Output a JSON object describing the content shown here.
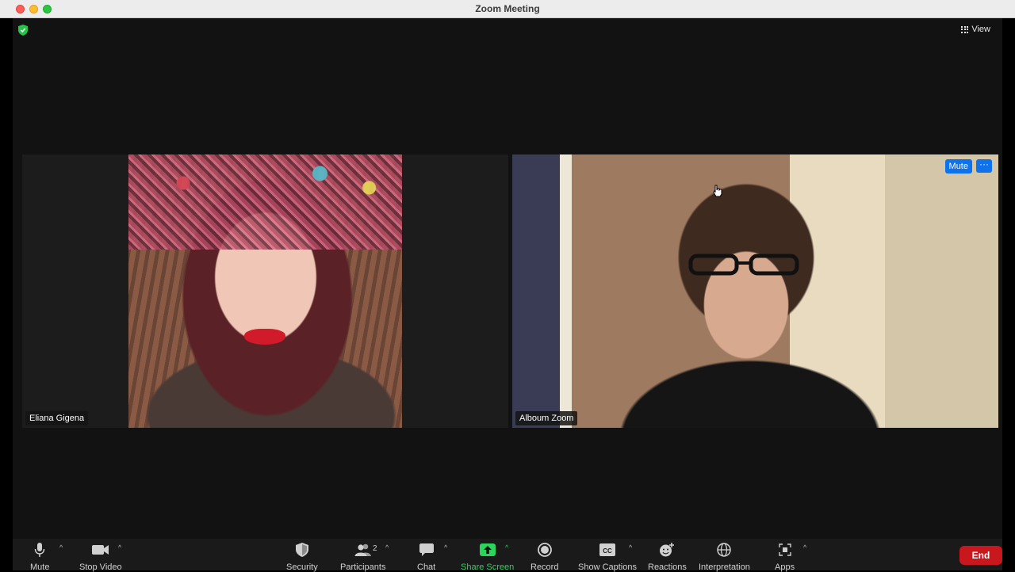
{
  "window": {
    "title": "Zoom Meeting"
  },
  "header": {
    "view_label": "View"
  },
  "participants_tiles": [
    {
      "name": "Eliana Gigena"
    },
    {
      "name": "Alboum Zoom",
      "mute_label": "Mute",
      "more_label": "···"
    }
  ],
  "toolbar": {
    "mute": "Mute",
    "stop_video": "Stop Video",
    "security": "Security",
    "participants": "Participants",
    "participants_count": "2",
    "chat": "Chat",
    "share_screen": "Share Screen",
    "record": "Record",
    "show_captions": "Show Captions",
    "reactions": "Reactions",
    "interpretation": "Interpretation",
    "apps": "Apps",
    "end": "End"
  },
  "colors": {
    "accent_blue": "#0e72ed",
    "end_red": "#c9171e",
    "share_green": "#2bd45b",
    "shield_green": "#24c449"
  }
}
